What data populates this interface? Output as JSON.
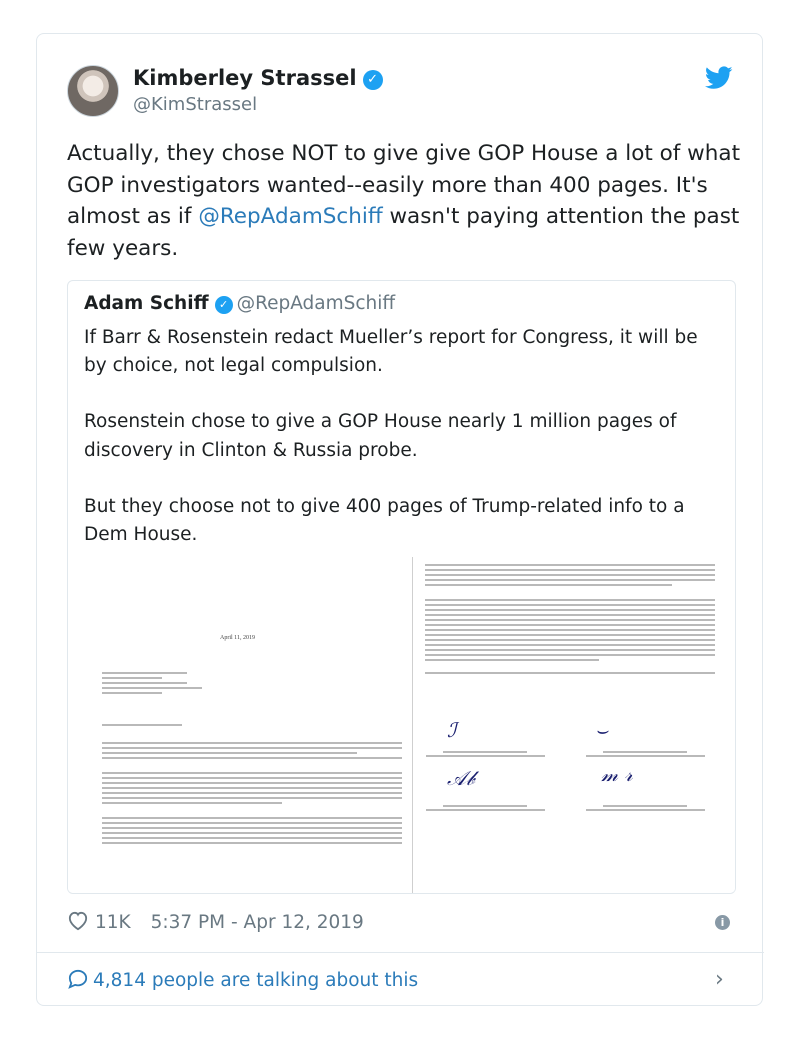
{
  "author": {
    "display_name": "Kimberley Strassel",
    "handle": "@KimStrassel"
  },
  "tweet": {
    "text_part1": "Actually, they chose NOT to give give GOP House a lot of what GOP investigators wanted--easily more than 400 pages. It's almost as if ",
    "mention": "@RepAdamSchiff",
    "text_part2": " wasn't paying attention the past few years."
  },
  "quoted": {
    "display_name": "Adam Schiff",
    "handle": "@RepAdamSchiff",
    "paragraphs": [
      "If Barr & Rosenstein redact Mueller’s report for Congress, it will be by choice, not legal compulsion.",
      "Rosenstein chose to give a GOP House nearly 1 million pages of discovery in Clinton & Russia probe.",
      "But they choose not to give 400 pages of Trump-related info to a Dem House."
    ],
    "doc_date": "April 11, 2019"
  },
  "meta": {
    "likes": "11K",
    "timestamp": "5:37 PM - Apr 12, 2019"
  },
  "footer": {
    "talking": "4,814 people are talking about this"
  },
  "icons": {
    "twitter_bird": "twitter-bird-icon",
    "verified": "verified-badge-icon",
    "heart": "heart-icon",
    "info": "info-icon",
    "comment": "comment-bubble-icon",
    "chevron": "chevron-right-icon"
  },
  "colors": {
    "link": "#2b7bb9",
    "verified": "#1da1f2",
    "muted": "#697882",
    "border": "#e1e8ed"
  }
}
